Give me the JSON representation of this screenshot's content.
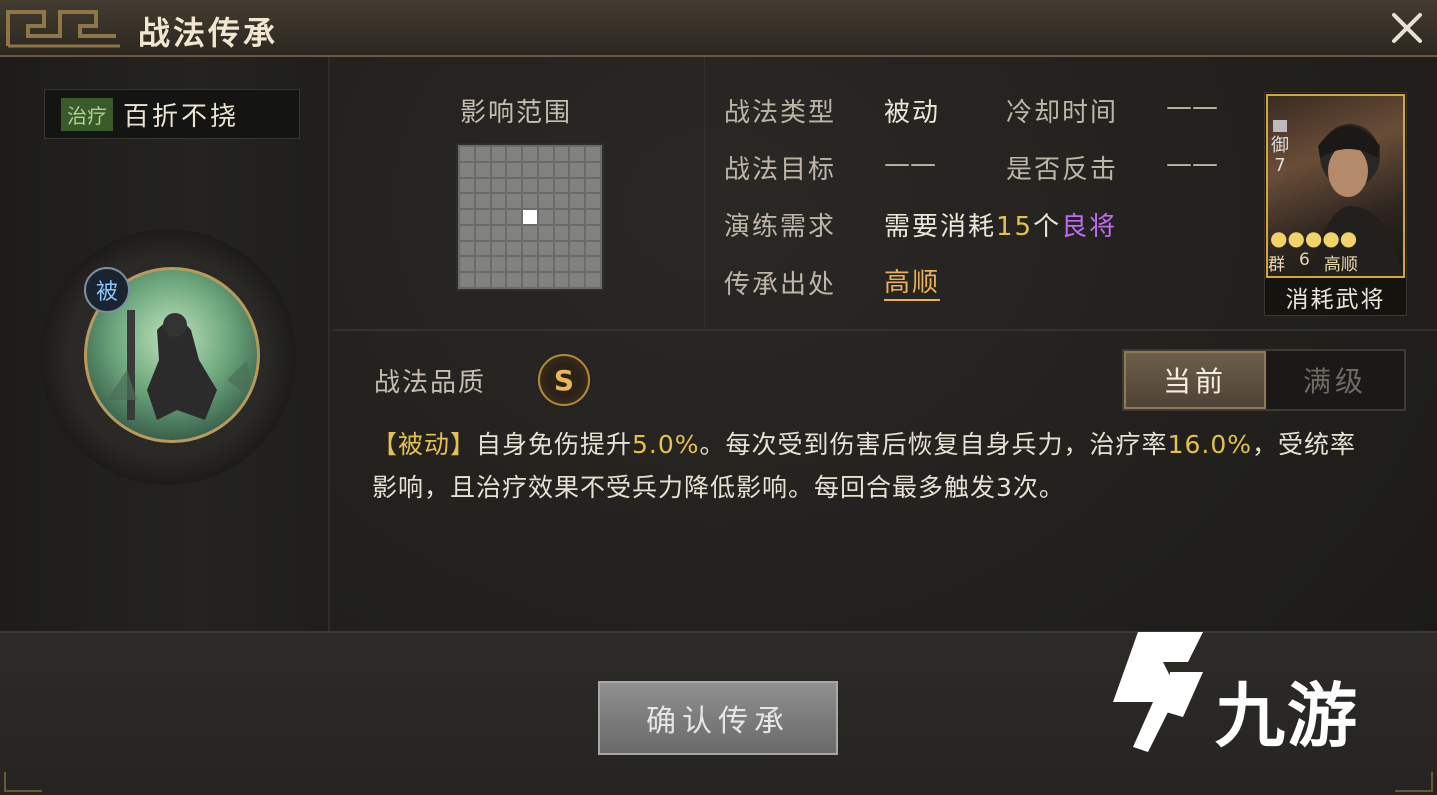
{
  "window": {
    "title": "战法传承"
  },
  "skill": {
    "tag": "治疗",
    "name": "百折不挠",
    "badge": "被"
  },
  "range": {
    "label": "影响范围",
    "grid_size": 9,
    "highlight_cell": [
      4,
      4
    ]
  },
  "info": {
    "type_label": "战法类型",
    "type_value": "被动",
    "cooldown_label": "冷却时间",
    "cooldown_value": "——",
    "target_label": "战法目标",
    "target_value": "——",
    "counter_label": "是否反击",
    "counter_value": "——",
    "practice_label": "演练需求",
    "practice_prefix": "需要消耗",
    "practice_count": "15",
    "practice_unit": "个",
    "practice_tier": "良将",
    "origin_label": "传承出处",
    "origin_value": "高顺"
  },
  "hero_card": {
    "rank_glyph": "御",
    "rank_level": "7",
    "stars": "●●●●●",
    "faction": "群",
    "cost": "6",
    "name": "高顺",
    "caption": "消耗武将"
  },
  "quality": {
    "label": "战法品质",
    "grade": "S"
  },
  "tabs": [
    {
      "label": "当前",
      "active": true
    },
    {
      "label": "满级",
      "active": false
    }
  ],
  "description": {
    "tag": "【被动】",
    "text1": "自身免伤提升",
    "val1": "5.0%",
    "text2": "。每次受到伤害后恢复自身兵力，治疗率",
    "val2": "16.0%",
    "text3": "，受统率影响，且治疗效果不受兵力降低影响。每回合最多触发3次。"
  },
  "footer": {
    "confirm_label": "确认传承"
  },
  "watermark": {
    "text": "九游"
  },
  "colors": {
    "accent_gold": "#e3c04f",
    "tier_purple": "#c06cf0",
    "origin_orange": "#eab05a",
    "heal_green": "#3b5a2c"
  }
}
